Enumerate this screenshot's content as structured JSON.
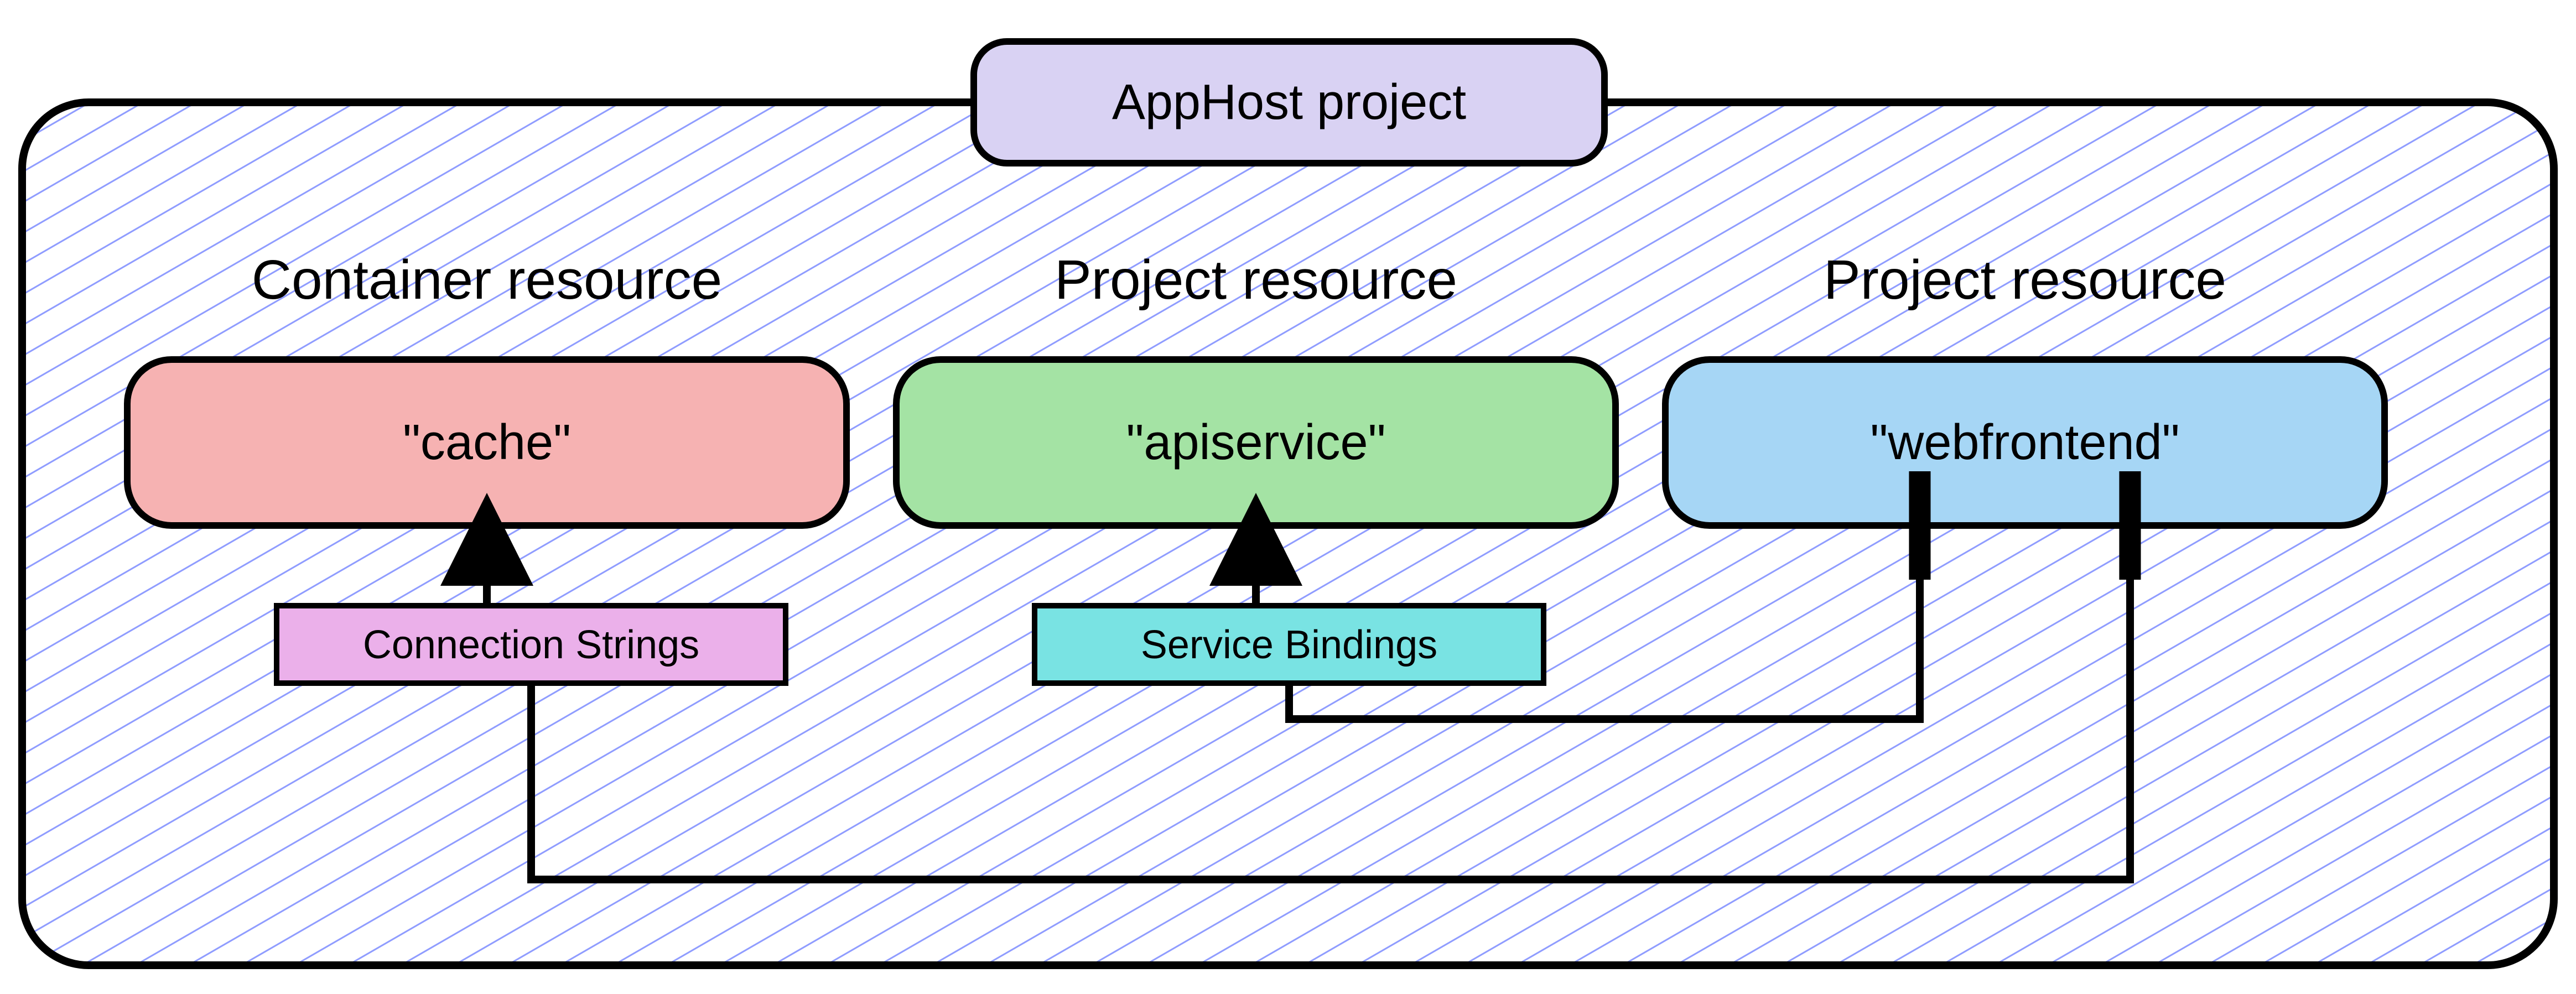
{
  "diagram": {
    "title": "AppHost project",
    "columns": [
      {
        "heading": "Container resource",
        "node": "\"cache\""
      },
      {
        "heading": "Project resource",
        "node": "\"apiservice\""
      },
      {
        "heading": "Project resource",
        "node": "\"webfrontend\""
      }
    ],
    "linkLabels": {
      "connectionStrings": "Connection Strings",
      "serviceBindings": "Service Bindings"
    },
    "colors": {
      "outerFill": "#ffffff",
      "hatchStroke": "#8f9cff",
      "titleFill": "#d9d2f3",
      "cacheFill": "#f6b2b2",
      "apiFill": "#a4e3a4",
      "webFill": "#a6d6f5",
      "connFill": "#ebb0ea",
      "bindFill": "#79e3e3",
      "stroke": "#000000"
    }
  }
}
